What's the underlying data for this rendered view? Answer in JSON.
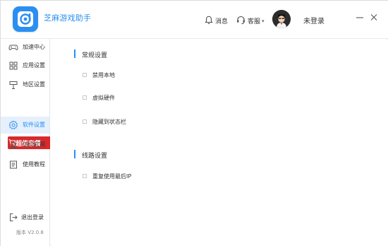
{
  "header": {
    "app_title": "芝麻游戏助手",
    "message_label": "消息",
    "service_label": "客服",
    "service_caret": "▾",
    "login_label": "未登录"
  },
  "sidebar": {
    "items": [
      {
        "label": "加速中心",
        "icon": "gamepad-icon"
      },
      {
        "label": "应用设置",
        "icon": "apps-grid-icon"
      },
      {
        "label": "地区设置",
        "icon": "flag-icon"
      },
      {
        "label": "软件设置",
        "icon": "gear-icon",
        "active": true
      },
      {
        "label": "访问官网",
        "icon": "globe-icon"
      },
      {
        "label": "使用教程",
        "icon": "book-icon"
      }
    ],
    "promo_label": "超值套餐",
    "logout_label": "退出登录",
    "version": "版本 V2.0.8"
  },
  "content": {
    "general": {
      "title": "常规设置",
      "options": [
        {
          "label": "禁用本地",
          "checked": false
        },
        {
          "label": "虚拟硬件",
          "checked": false
        },
        {
          "label": "隐藏到状态栏",
          "checked": false
        }
      ]
    },
    "route": {
      "title": "线路设置",
      "options": [
        {
          "label": "重复使用最后IP",
          "checked": false
        }
      ]
    }
  },
  "colors": {
    "accent": "#2b8ff2",
    "active_bg": "#e5f0fc",
    "promo_red": "#d9292b"
  }
}
